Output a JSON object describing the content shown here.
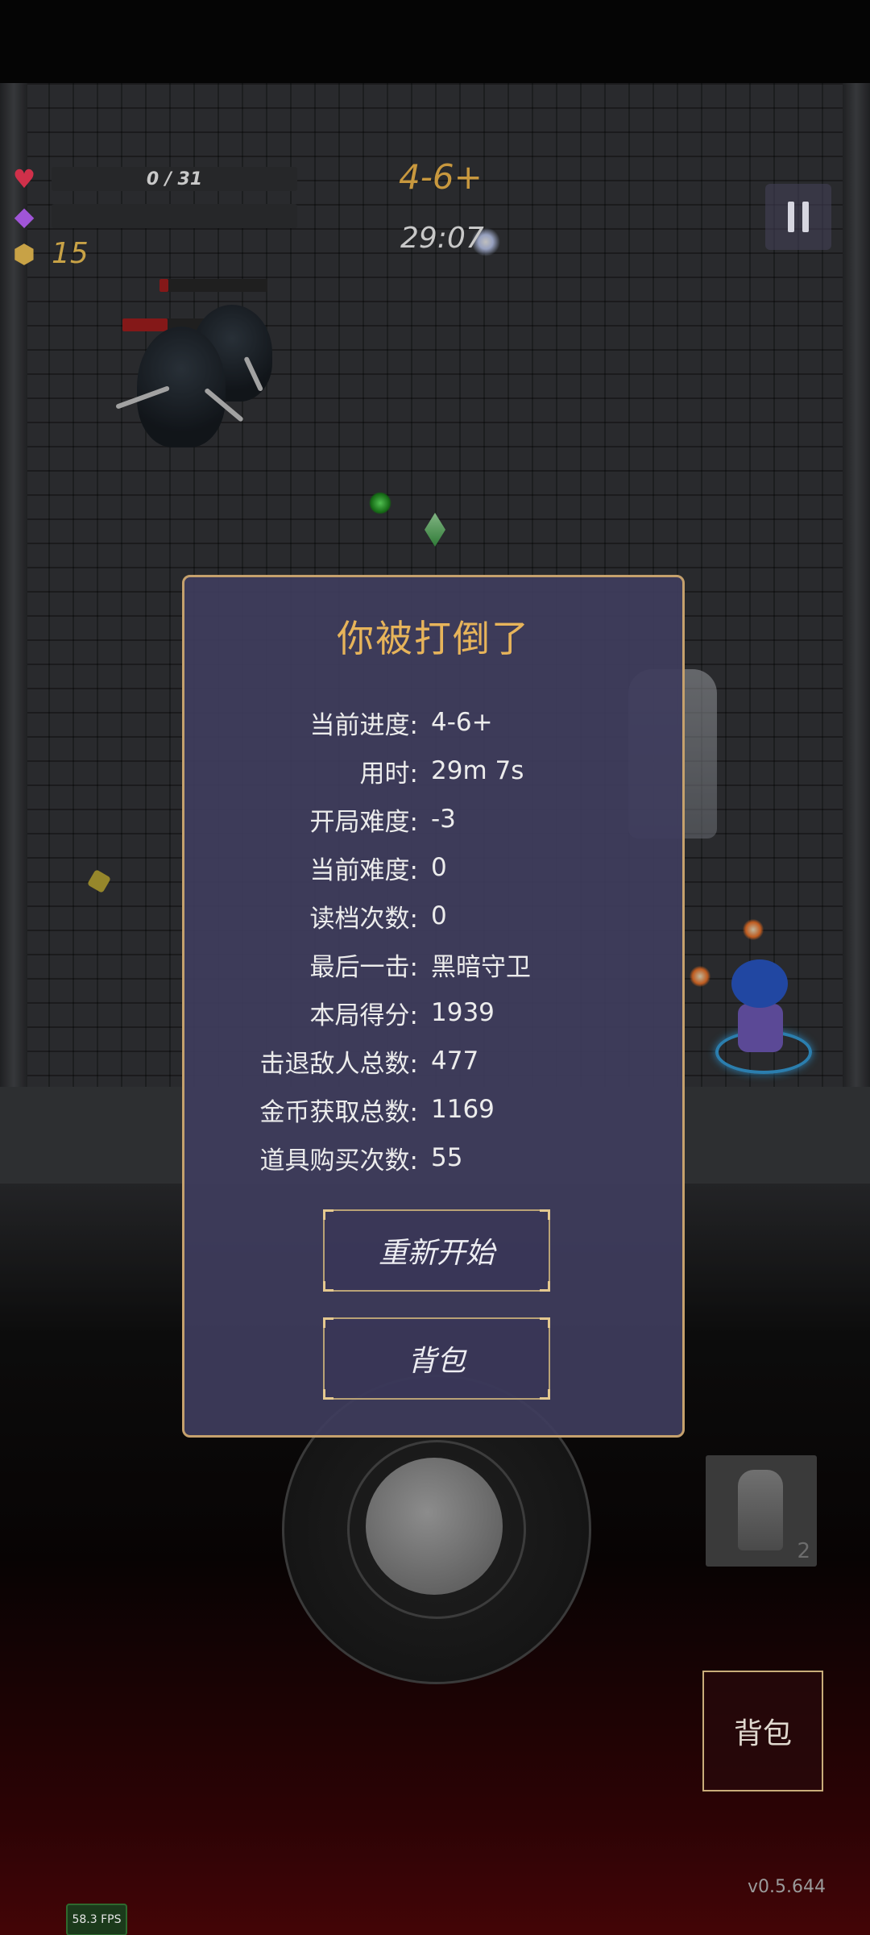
{
  "hud": {
    "health_text": "0 / 31",
    "health_icon": "heart-icon",
    "mana_icon": "gem-icon",
    "coin_icon": "coin-icon",
    "coin_count": "15",
    "level": "4-6+",
    "timer": "29:07",
    "pause_icon": "pause-icon"
  },
  "dialog": {
    "title": "你被打倒了",
    "stats": [
      {
        "label": "当前进度:",
        "value": "4-6+"
      },
      {
        "label": "用时:",
        "value": "29m 7s"
      },
      {
        "label": "开局难度:",
        "value": "-3"
      },
      {
        "label": "当前难度:",
        "value": "0"
      },
      {
        "label": "读档次数:",
        "value": "0"
      },
      {
        "label": "最后一击:",
        "value": "黑暗守卫"
      },
      {
        "label": "本局得分:",
        "value": "1939"
      },
      {
        "label": "击退敌人总数:",
        "value": "477"
      },
      {
        "label": "金币获取总数:",
        "value": "1169"
      },
      {
        "label": "道具购买次数:",
        "value": "55"
      }
    ],
    "restart_label": "重新开始",
    "bag_label": "背包"
  },
  "skill": {
    "count": "2"
  },
  "bag_button_label": "背包",
  "fps": "58.3 FPS",
  "version": "v0.5.644",
  "colors": {
    "accent_gold": "#c5a16d",
    "title": "#e7b45a",
    "health": "#c0304a",
    "mana": "#9b4fd0",
    "coin": "#c8a246"
  }
}
